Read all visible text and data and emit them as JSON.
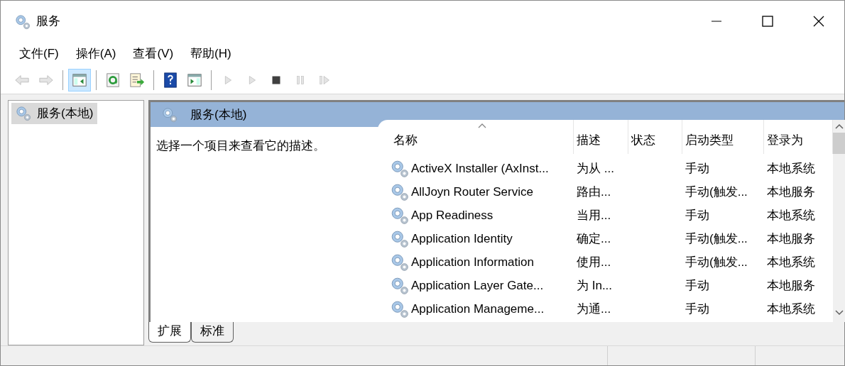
{
  "window": {
    "title": "服务"
  },
  "menu": [
    {
      "label": "文件(F)"
    },
    {
      "label": "操作(A)"
    },
    {
      "label": "查看(V)"
    },
    {
      "label": "帮助(H)"
    }
  ],
  "toolbar": [
    {
      "kind": "back",
      "disabled": true,
      "pressed": false
    },
    {
      "kind": "forward",
      "disabled": true,
      "pressed": false
    },
    {
      "kind": "separator"
    },
    {
      "kind": "console-tree",
      "disabled": false,
      "pressed": true
    },
    {
      "kind": "separator"
    },
    {
      "kind": "refresh",
      "disabled": false,
      "pressed": false
    },
    {
      "kind": "export",
      "disabled": false,
      "pressed": false
    },
    {
      "kind": "separator"
    },
    {
      "kind": "help",
      "disabled": false,
      "pressed": false
    },
    {
      "kind": "action-pane",
      "disabled": false,
      "pressed": false
    },
    {
      "kind": "separator"
    },
    {
      "kind": "play",
      "disabled": true,
      "pressed": false
    },
    {
      "kind": "play",
      "disabled": true,
      "pressed": false
    },
    {
      "kind": "stop",
      "disabled": false,
      "pressed": false
    },
    {
      "kind": "pause",
      "disabled": true,
      "pressed": false
    },
    {
      "kind": "restart",
      "disabled": true,
      "pressed": false
    }
  ],
  "tree": [
    {
      "label": "服务(本地)",
      "selected": true
    }
  ],
  "pane": {
    "title": "服务(本地)",
    "description": "选择一个项目来查看它的描述。"
  },
  "table": {
    "columns": [
      {
        "label": "名称",
        "sorted": true
      },
      {
        "label": "描述",
        "sorted": false
      },
      {
        "label": "状态",
        "sorted": false
      },
      {
        "label": "启动类型",
        "sorted": false
      },
      {
        "label": "登录为",
        "sorted": false
      }
    ],
    "rows": [
      {
        "name": "ActiveX Installer (AxInst...",
        "description": "为从 ...",
        "startup_type": "手动",
        "log_on_as": "本地系统"
      },
      {
        "name": "AllJoyn Router Service",
        "description": "路由...",
        "startup_type": "手动(触发...",
        "log_on_as": "本地服务"
      },
      {
        "name": "App Readiness",
        "description": "当用...",
        "startup_type": "手动",
        "log_on_as": "本地系统"
      },
      {
        "name": "Application Identity",
        "description": "确定...",
        "startup_type": "手动(触发...",
        "log_on_as": "本地服务"
      },
      {
        "name": "Application Information",
        "description": "使用...",
        "startup_type": "手动(触发...",
        "log_on_as": "本地系统"
      },
      {
        "name": "Application Layer Gate...",
        "description": "为 In...",
        "startup_type": "手动",
        "log_on_as": "本地服务"
      },
      {
        "name": "Application Manageme...",
        "description": "为通...",
        "startup_type": "手动",
        "log_on_as": "本地系统"
      }
    ]
  },
  "view_tabs": [
    {
      "label": "扩展",
      "selected": true
    },
    {
      "label": "标准",
      "selected": false
    }
  ]
}
